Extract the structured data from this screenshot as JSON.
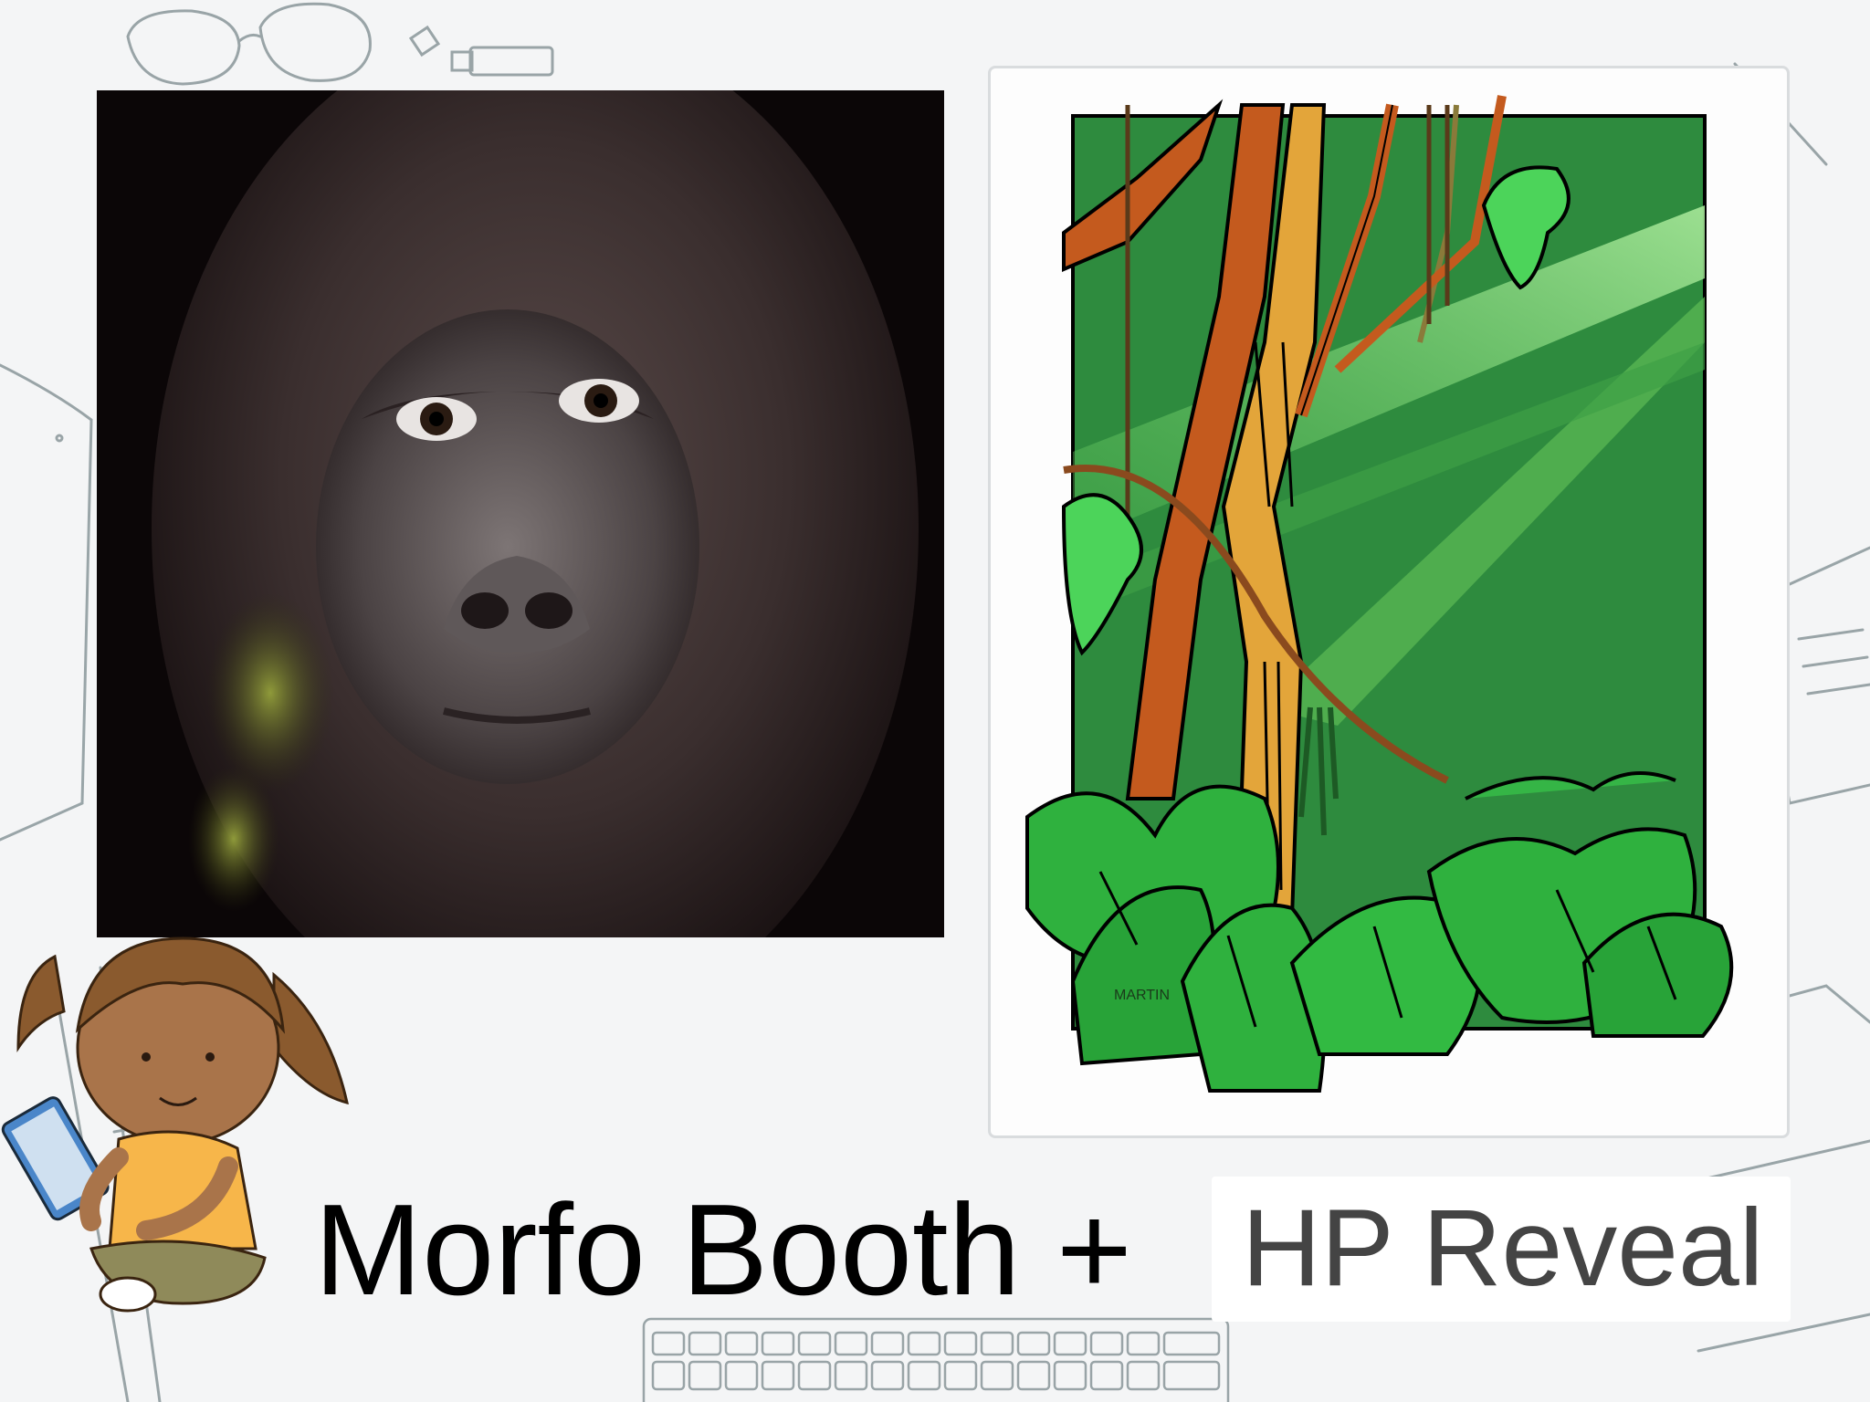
{
  "slide": {
    "title_main": "Morfo Booth +",
    "title_highlight": "HP Reveal"
  },
  "images": {
    "left_photo": "gorilla-face-photo",
    "right_illustration": "rainforest-clipart",
    "right_illustration_signature": "MARTIN",
    "bottom_left_clipart": "girl-with-tablet-clipart"
  },
  "colors": {
    "background": "#f4f5f6",
    "sketch_lines": "#7b8a8d",
    "title_main": "#000000",
    "title_highlight": "#444444",
    "jungle_bg": "#2e8b3e",
    "jungle_leaf": "#38b24a",
    "jungle_trunk": "#c45a1e"
  }
}
